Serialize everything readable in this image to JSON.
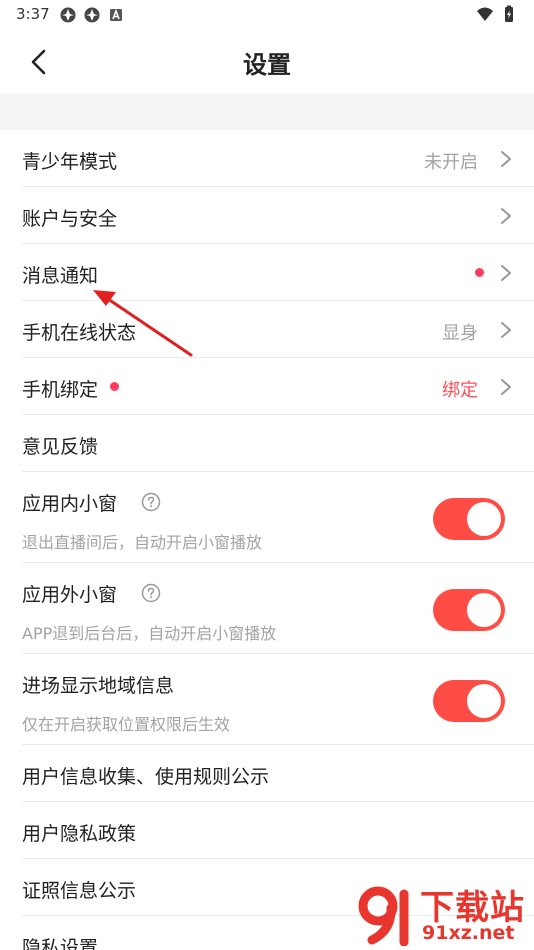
{
  "status_bar": {
    "time": "3:37"
  },
  "header": {
    "title": "设置"
  },
  "rows": {
    "youth_mode": {
      "title": "青少年模式",
      "value": "未开启"
    },
    "account_security": {
      "title": "账户与安全"
    },
    "notifications": {
      "title": "消息通知"
    },
    "phone_online": {
      "title": "手机在线状态",
      "value": "显身"
    },
    "phone_binding": {
      "title": "手机绑定",
      "value": "绑定"
    },
    "feedback": {
      "title": "意见反馈"
    },
    "in_app_window": {
      "title": "应用内小窗",
      "subtitle": "退出直播间后，自动开启小窗播放",
      "enabled": true
    },
    "out_app_window": {
      "title": "应用外小窗",
      "subtitle": "APP退到后台后，自动开启小窗播放",
      "enabled": true
    },
    "region_display": {
      "title": "进场显示地域信息",
      "subtitle": "仅在开启获取位置权限后生效",
      "enabled": true
    },
    "info_rules": {
      "title": "用户信息收集、使用规则公示"
    },
    "privacy_policy": {
      "title": "用户隐私政策"
    },
    "license_info": {
      "title": "证照信息公示"
    },
    "privacy_settings": {
      "title": "隐私设置"
    }
  },
  "watermark": {
    "text": "下载站",
    "url": "91xz.net"
  },
  "colors": {
    "accent": "#ff4d45",
    "badge": "#ff3c5a",
    "secondary_text": "#a3a3a3",
    "annotation_arrow": "#e02020"
  }
}
